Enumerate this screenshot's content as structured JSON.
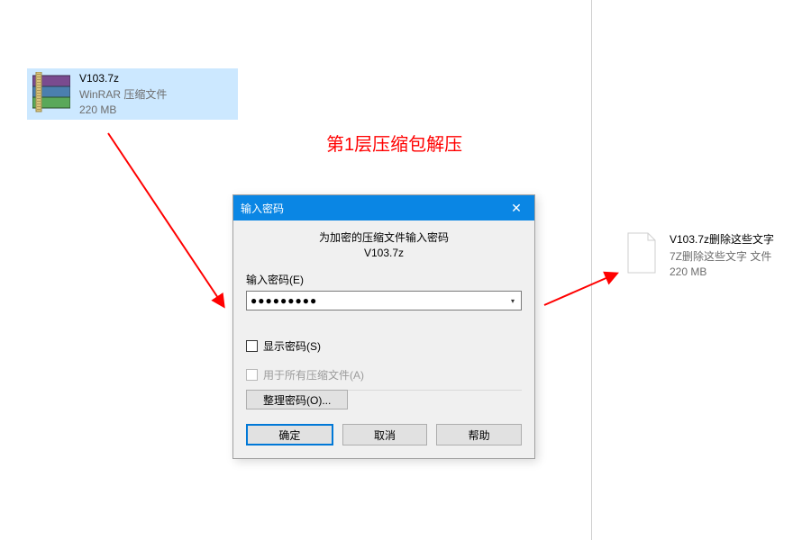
{
  "annotation": {
    "title": "第1层压缩包解压"
  },
  "leftFile": {
    "name": "V103.7z",
    "type": "WinRAR 压缩文件",
    "size": "220 MB"
  },
  "rightFile": {
    "name": "V103.7z删除这些文字",
    "type": "7Z删除这些文字 文件",
    "size": "220 MB"
  },
  "dialog": {
    "title": "输入密码",
    "headerLine1": "为加密的压缩文件输入密码",
    "headerLine2": "V103.7z",
    "passwordLabel": "输入密码(E)",
    "passwordValue": "●●●●●●●●●",
    "showPasswordLabel": "显示密码(S)",
    "useForAllLabel": "用于所有压缩文件(A)",
    "organizeLabel": "整理密码(O)...",
    "okLabel": "确定",
    "cancelLabel": "取消",
    "helpLabel": "帮助"
  }
}
